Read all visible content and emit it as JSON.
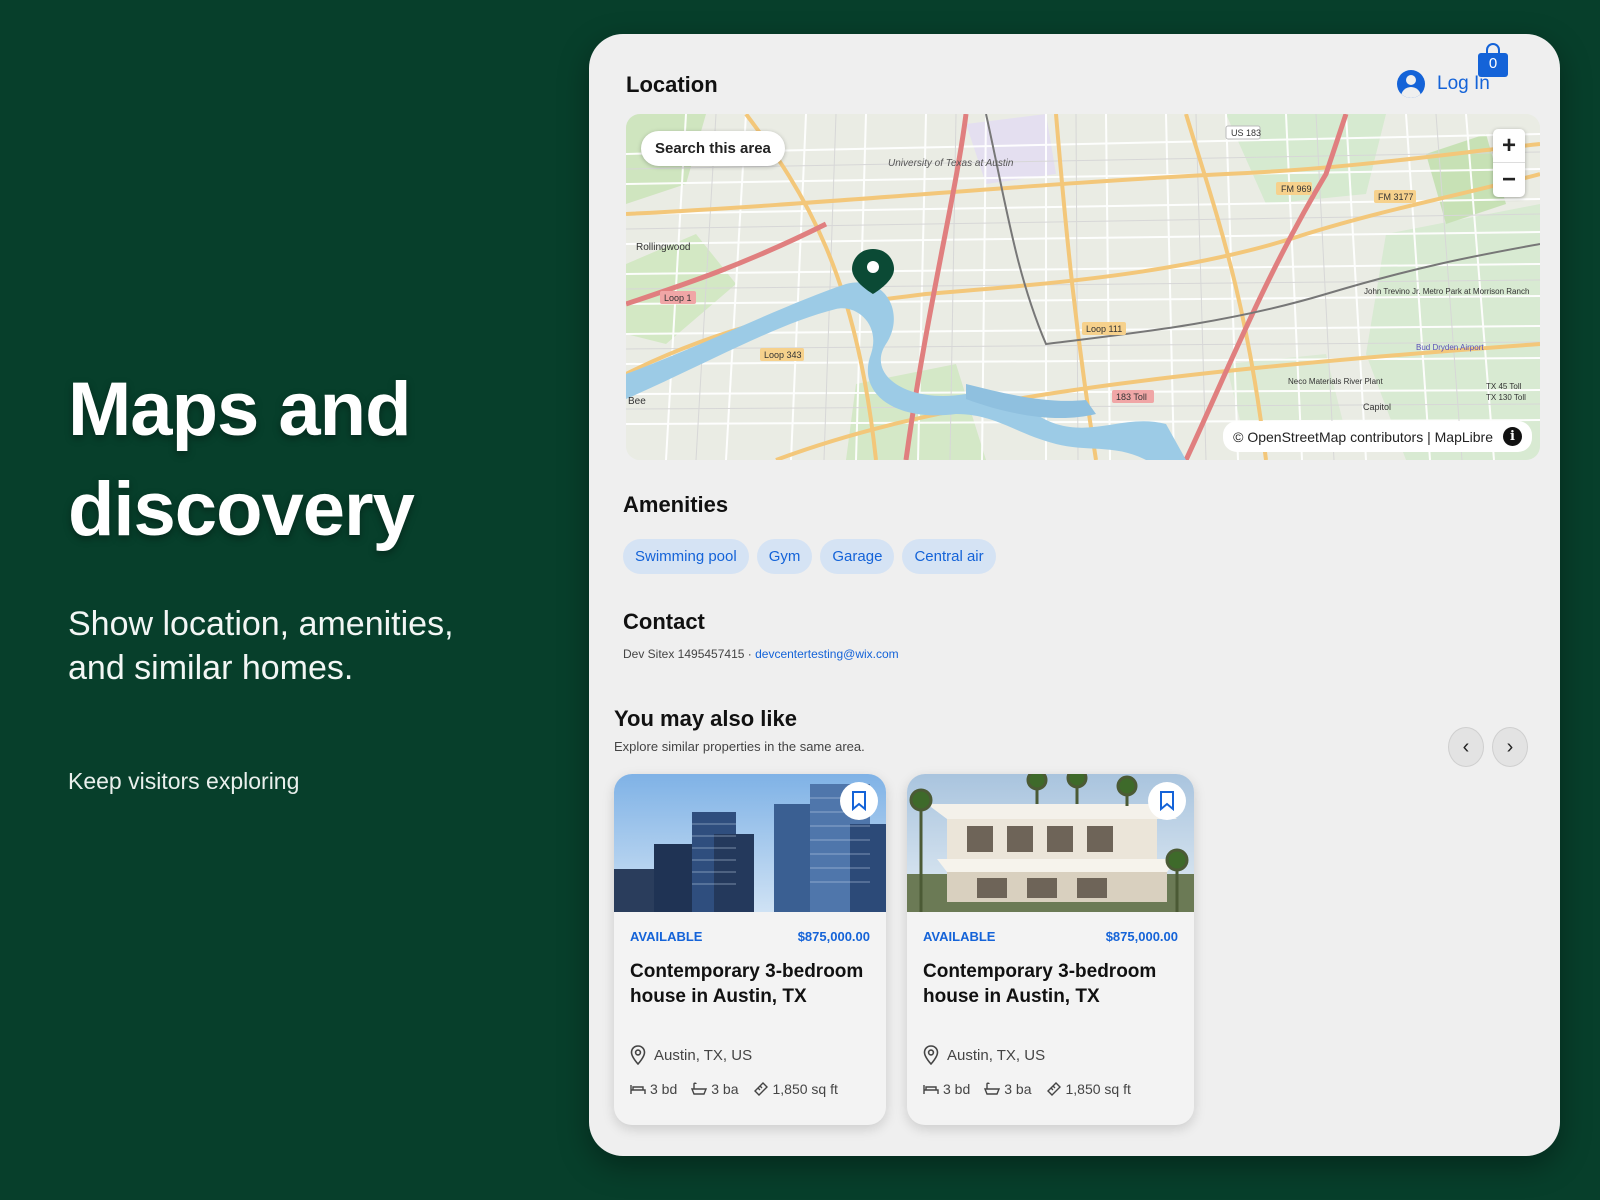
{
  "hero": {
    "title_line1": "Maps and",
    "title_line2": "discovery",
    "subtitle": "Show location, amenities, and similar homes.",
    "tagline": "Keep visitors exploring"
  },
  "header": {
    "cart_count": "0",
    "login_label": "Log In"
  },
  "location": {
    "title": "Location",
    "search_label": "Search this area",
    "zoom_in": "+",
    "zoom_out": "−",
    "attribution": "© OpenStreetMap contributors | MapLibre",
    "info_glyph": "i",
    "labels": [
      "University of Texas at Austin",
      "Rollingwood",
      "Loop 1",
      "Loop 343",
      "Loop 111",
      "183 Toll",
      "US 183",
      "FM 969",
      "FM 3177",
      "Bee",
      "Capitol",
      "Neco Materials River Plant",
      "John Trevino Jr. Metro Park at Morrison Ranch",
      "Bud Dryden Airport",
      "TX 45 Toll",
      "TX 130 Toll"
    ]
  },
  "amenities": {
    "title": "Amenities",
    "items": [
      "Swimming pool",
      "Gym",
      "Garage",
      "Central air"
    ]
  },
  "contact": {
    "title": "Contact",
    "text": "Dev Sitex 1495457415 · ",
    "email": "devcentertesting@wix.com"
  },
  "similar": {
    "title": "You may also like",
    "subtitle": "Explore similar properties in the same area.",
    "prev_glyph": "‹",
    "next_glyph": "›",
    "cards": [
      {
        "status": "AVAILABLE",
        "price": "$875,000.00",
        "title": "Contemporary 3-bedroom house in Austin, TX",
        "location": "Austin, TX, US",
        "beds": "3 bd",
        "baths": "3 ba",
        "area": "1,850 sq ft"
      },
      {
        "status": "AVAILABLE",
        "price": "$875,000.00",
        "title": "Contemporary 3-bedroom house in Austin, TX",
        "location": "Austin, TX, US",
        "beds": "3 bd",
        "baths": "3 ba",
        "area": "1,850 sq ft"
      }
    ]
  },
  "colors": {
    "background": "#073f2b",
    "accent": "#1463d8",
    "panel": "#efefef",
    "chip": "#d5e3f4",
    "map_pin": "#0b4a35"
  },
  "icons": [
    "cart-icon",
    "user-icon",
    "map-pin-icon",
    "info-icon",
    "bookmark-icon",
    "location-icon",
    "bed-icon",
    "bath-icon",
    "area-icon",
    "chevron-left-icon",
    "chevron-right-icon"
  ]
}
